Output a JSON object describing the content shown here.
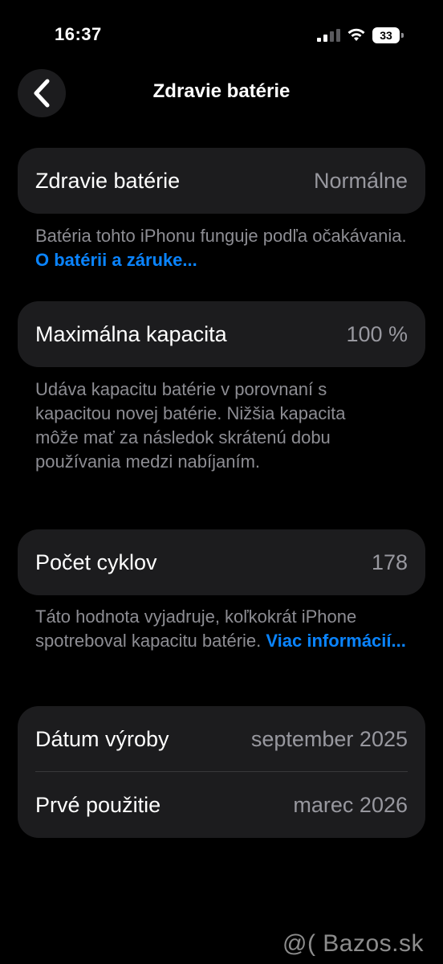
{
  "status_bar": {
    "time": "16:37",
    "battery_level": "33",
    "icons": [
      "cellular-signal-icon",
      "wifi-icon",
      "battery-icon"
    ]
  },
  "nav": {
    "back_icon": "chevron-left-icon",
    "title": "Zdravie batérie"
  },
  "battery_health": {
    "label": "Zdravie batérie",
    "value": "Normálne",
    "footnote_text": "Batéria tohto iPhonu funguje podľa očakávania. ",
    "footnote_link": "O batérii a záruke..."
  },
  "max_capacity": {
    "label": "Maximálna kapacita",
    "value": "100 %",
    "footnote_text": "Udáva kapacitu batérie v porovnaní s kapacitou novej batérie. Nižšia kapacita môže mať za následok skrátenú dobu používania medzi nabíjaním."
  },
  "cycle_count": {
    "label": "Počet cyklov",
    "value": "178",
    "footnote_text": "Táto hodnota vyjadruje, koľkokrát iPhone spotreboval kapacitu batérie. ",
    "footnote_link": "Viac informácií..."
  },
  "dates": {
    "manufacture_label": "Dátum výroby",
    "manufacture_value": "september 2025",
    "first_use_label": "Prvé použitie",
    "first_use_value": "marec 2026"
  },
  "watermark": "@( Bazos.sk",
  "colors": {
    "background": "#000000",
    "card": "#1c1c1e",
    "secondary_text": "#98989f",
    "link": "#0a84ff"
  }
}
